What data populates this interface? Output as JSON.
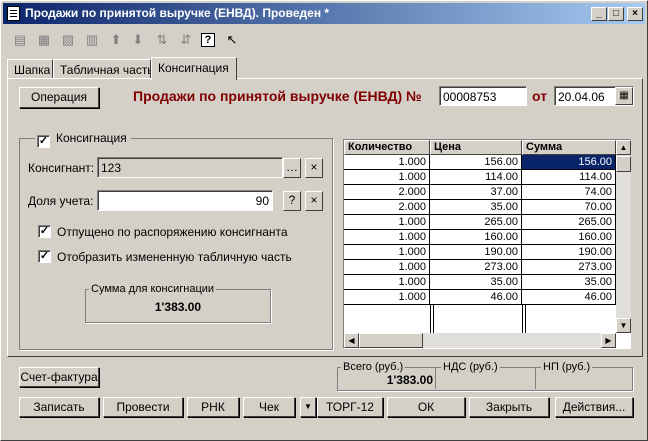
{
  "window": {
    "title": "Продажи по принятой выручке (ЕНВД). Проведен *"
  },
  "tabs": [
    "Шапка",
    "Табличная часть",
    "Консигнация"
  ],
  "operation_button": "Операция",
  "document": {
    "heading": "Продажи по принятой выручке (ЕНВД) №",
    "number": "00008753",
    "date_label": "от",
    "date": "20.04.06"
  },
  "consignment": {
    "checkbox_label": "Консигнация",
    "consignor_label": "Консигнант:",
    "consignor_value": "123",
    "share_label": "Доля учета:",
    "share_value": "90",
    "released_label": "Отпущено по распоряжению консигнанта",
    "show_changed_label": "Отобразить измененную табличную часть",
    "sum_label": "Сумма для консигнации",
    "sum_value": "1'383.00"
  },
  "grid": {
    "columns": [
      "Количество",
      "Цена",
      "Сумма"
    ],
    "rows": [
      [
        "1.000",
        "156.00",
        "156.00"
      ],
      [
        "1.000",
        "114.00",
        "114.00"
      ],
      [
        "2.000",
        "37.00",
        "74.00"
      ],
      [
        "2.000",
        "35.00",
        "70.00"
      ],
      [
        "1.000",
        "265.00",
        "265.00"
      ],
      [
        "1.000",
        "160.00",
        "160.00"
      ],
      [
        "1.000",
        "190.00",
        "190.00"
      ],
      [
        "1.000",
        "273.00",
        "273.00"
      ],
      [
        "1.000",
        "35.00",
        "35.00"
      ],
      [
        "1.000",
        "46.00",
        "46.00"
      ]
    ]
  },
  "totals": {
    "total_label": "Всего (руб.)",
    "total_value": "1'383.00",
    "vat_label": "НДС (руб.)",
    "np_label": "НП (руб.)"
  },
  "buttons": {
    "invoice": "Счет-фактура",
    "save": "Записать",
    "post": "Провести",
    "rnk": "РНК",
    "check": "Чек",
    "torg": "ТОРГ-12",
    "ok": "ОК",
    "close": "Закрыть",
    "actions": "Действия..."
  }
}
